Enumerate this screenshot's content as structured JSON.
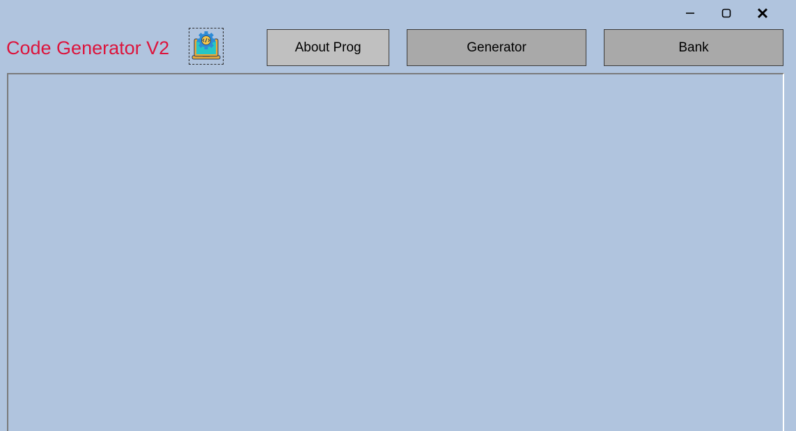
{
  "app": {
    "title": "Code Generator V2",
    "logo_icon": "laptop-gear-code-icon"
  },
  "window_controls": {
    "minimize_icon": "minimize-icon",
    "maximize_icon": "maximize-icon",
    "close_icon": "close-icon"
  },
  "nav": {
    "about_label": "About Prog",
    "generator_label": "Generator",
    "bank_label": "Bank"
  },
  "colors": {
    "background": "#b0c4de",
    "title": "#dc143c",
    "active_button": "#c0c0c0",
    "inactive_button": "#a9a9a9"
  }
}
